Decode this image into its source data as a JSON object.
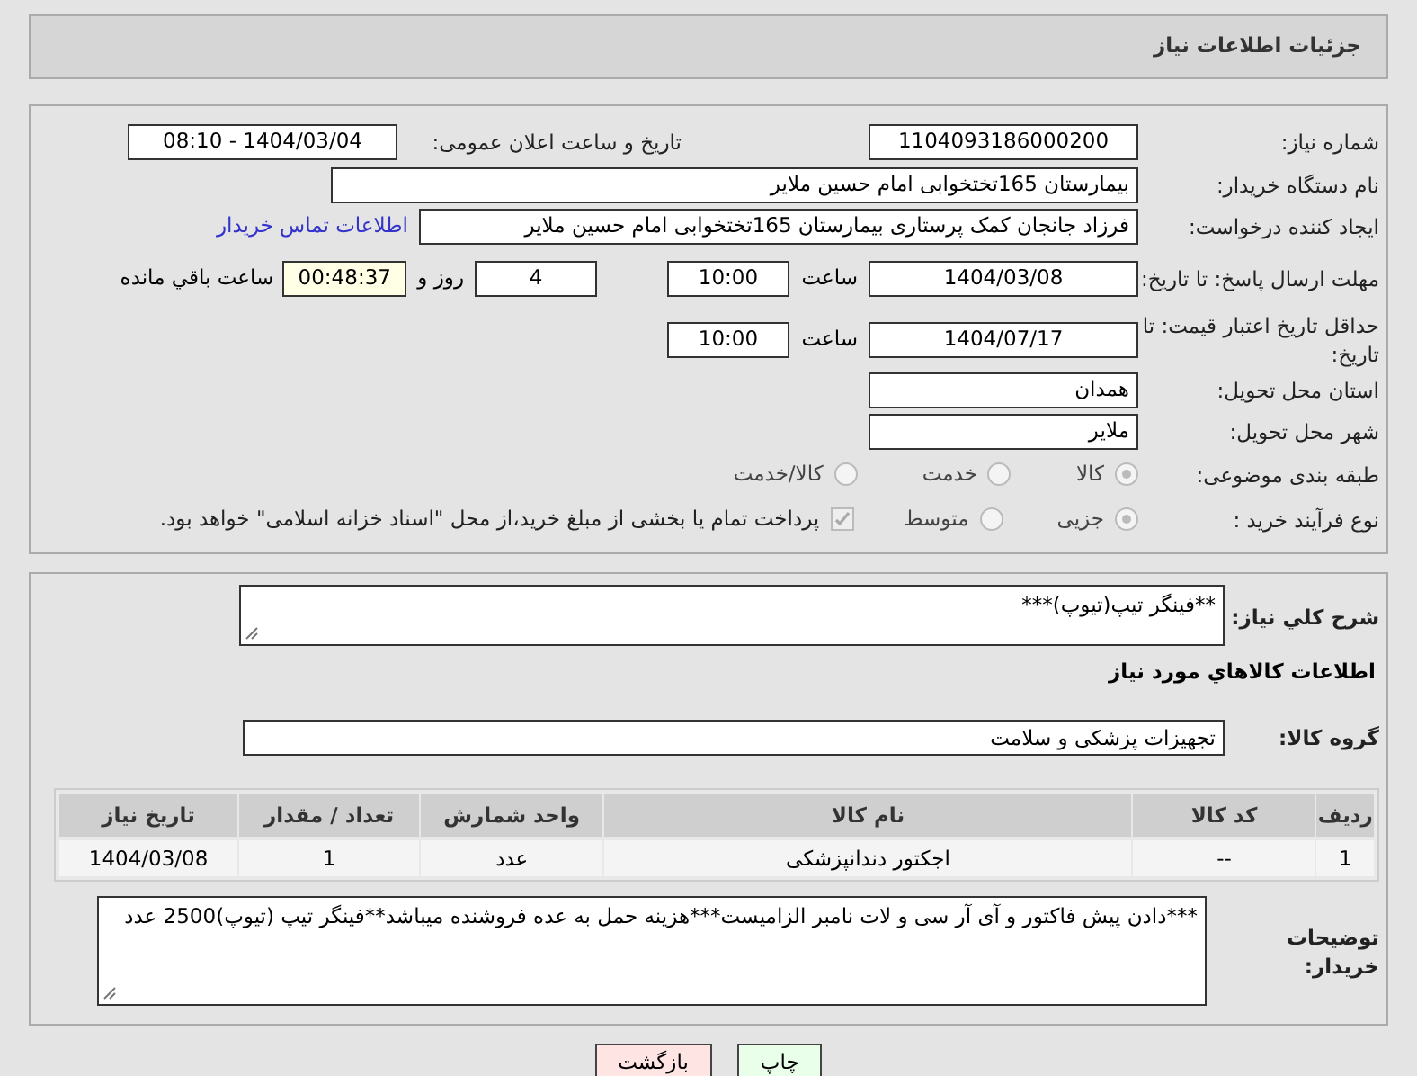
{
  "header": {
    "title": "جزئیات اطلاعات نیاز"
  },
  "need_number": {
    "label": "شماره نیاز:",
    "value": "1104093186000200"
  },
  "announce": {
    "label": "تاریخ و ساعت اعلان عمومی:",
    "value": "1404/03/04 - 08:10"
  },
  "buyer": {
    "label": "نام دستگاه خریدار:",
    "value": "بیمارستان 165تختخوابی امام حسین ملایر"
  },
  "creator": {
    "label": "ایجاد کننده درخواست:",
    "value": "فرزاد جانجان کمک پرستاری بیمارستان 165تختخوابی امام حسین ملایر",
    "link": "اطلاعات تماس خریدار"
  },
  "deadline": {
    "label": "مهلت ارسال پاسخ: تا تاریخ:",
    "date": "1404/03/08",
    "time_label": "ساعت",
    "time": "10:00",
    "days": "4",
    "days_label": "روز و",
    "remaining": "00:48:37",
    "remaining_label": "ساعت باقي مانده"
  },
  "validity": {
    "label": "حداقل تاریخ اعتبار قیمت: تا تاریخ:",
    "date": "1404/07/17",
    "time_label": "ساعت",
    "time": "10:00"
  },
  "province": {
    "label": "استان محل تحویل:",
    "value": "همدان"
  },
  "city": {
    "label": "شهر محل تحویل:",
    "value": "ملایر"
  },
  "category": {
    "label": "طبقه بندی موضوعی:",
    "options": [
      {
        "label": "کالا",
        "selected": true
      },
      {
        "label": "خدمت",
        "selected": false
      },
      {
        "label": "کالا/خدمت",
        "selected": false
      }
    ]
  },
  "process": {
    "label": "نوع فرآیند خرید :",
    "options": [
      {
        "label": "جزیی",
        "selected": true
      },
      {
        "label": "متوسط",
        "selected": false
      }
    ],
    "treasury": {
      "label": "پرداخت تمام یا بخشی از مبلغ خرید،از محل \"اسناد خزانه اسلامی\" خواهد بود.",
      "checked": true
    }
  },
  "summary": {
    "label": "شرح كلي نياز:",
    "value": "**فینگر تیپ(تیوپ)***"
  },
  "goods_heading": "اطلاعات كالاهاي مورد نياز",
  "goods_group": {
    "label": "گروه کالا:",
    "value": "تجهیزات پزشکی و سلامت"
  },
  "table": {
    "columns": [
      "ردیف",
      "کد کالا",
      "نام کالا",
      "واحد شمارش",
      "تعداد / مقدار",
      "تاریخ نیاز"
    ],
    "rows": [
      [
        "1",
        "--",
        "اجکتور دندانپزشکی",
        "عدد",
        "1",
        "1404/03/08"
      ]
    ]
  },
  "notes": {
    "label": "توضیحات خریدار:",
    "value": "***دادن پیش فاکتور و آی آر سی و لات نامبر الزامیست***هزینه حمل به عده فروشنده میباشد**فینگر تیپ (تیوپ)2500 عدد"
  },
  "buttons": [
    {
      "label": "چاپ",
      "kind": "print"
    },
    {
      "label": "بازگشت",
      "kind": "back"
    }
  ]
}
